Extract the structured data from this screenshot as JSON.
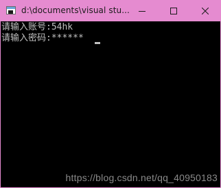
{
  "window": {
    "title": "d:\\documents\\visual stu...",
    "accent_color": "#e58bd0",
    "controls": {
      "minimize_icon": "minimize-icon",
      "maximize_icon": "maximize-icon",
      "close_icon": "close-icon"
    }
  },
  "console": {
    "lines": [
      "请输入账号:54hk",
      "请输入密码:******"
    ],
    "background": "#000000",
    "text_color": "#c0c0c0"
  },
  "watermark": {
    "text": "https://blog.csdn.net/qq_40950183"
  }
}
